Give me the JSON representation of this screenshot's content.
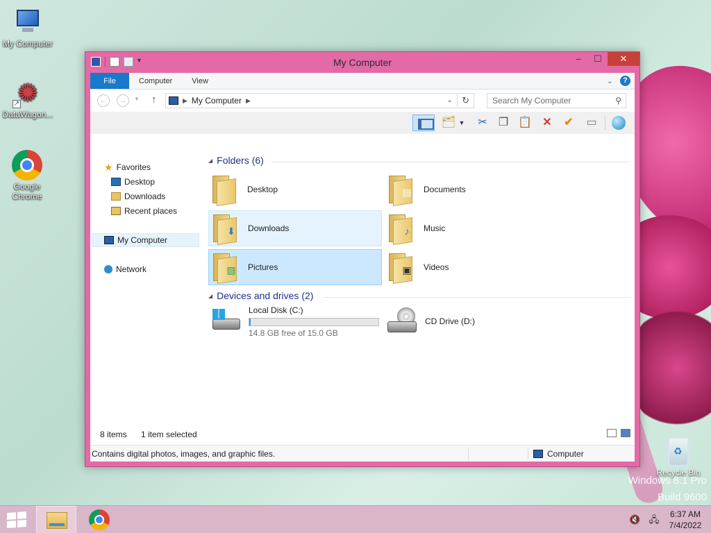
{
  "desktop": {
    "icons": [
      {
        "label": "My Computer"
      },
      {
        "label": "DataWagon..."
      },
      {
        "label": "Google Chrome"
      }
    ],
    "recycle_bin": "Recycle Bin",
    "watermark_line1": "Windows 8.1 Pro",
    "watermark_line2": "Build 9600"
  },
  "window": {
    "title": "My Computer",
    "controls": {
      "minimize": "–",
      "maximize": "☐",
      "close": "✕"
    },
    "ribbon_tabs": [
      "File",
      "Computer",
      "View"
    ],
    "address": {
      "crumb": "My Computer"
    },
    "search": {
      "placeholder": "Search My Computer"
    },
    "nav": {
      "favorites": "Favorites",
      "desktop": "Desktop",
      "downloads": "Downloads",
      "recent": "Recent places",
      "my_computer": "My Computer",
      "network": "Network"
    },
    "groups": {
      "folders": "Folders (6)",
      "devices": "Devices and drives (2)"
    },
    "folders": [
      {
        "label": "Desktop"
      },
      {
        "label": "Documents"
      },
      {
        "label": "Downloads"
      },
      {
        "label": "Music"
      },
      {
        "label": "Pictures"
      },
      {
        "label": "Videos"
      }
    ],
    "drives": [
      {
        "label": "Local Disk (C:)",
        "free": "14.8 GB free of 15.0 GB",
        "used_fraction": 0.013
      },
      {
        "label": "CD Drive (D:)"
      }
    ],
    "status": {
      "items": "8 items",
      "selected": "1 item selected"
    },
    "details": {
      "description": "Contains digital photos, images, and graphic files.",
      "location": "Computer"
    }
  },
  "taskbar": {
    "time": "6:37 AM",
    "date": "7/4/2022"
  }
}
